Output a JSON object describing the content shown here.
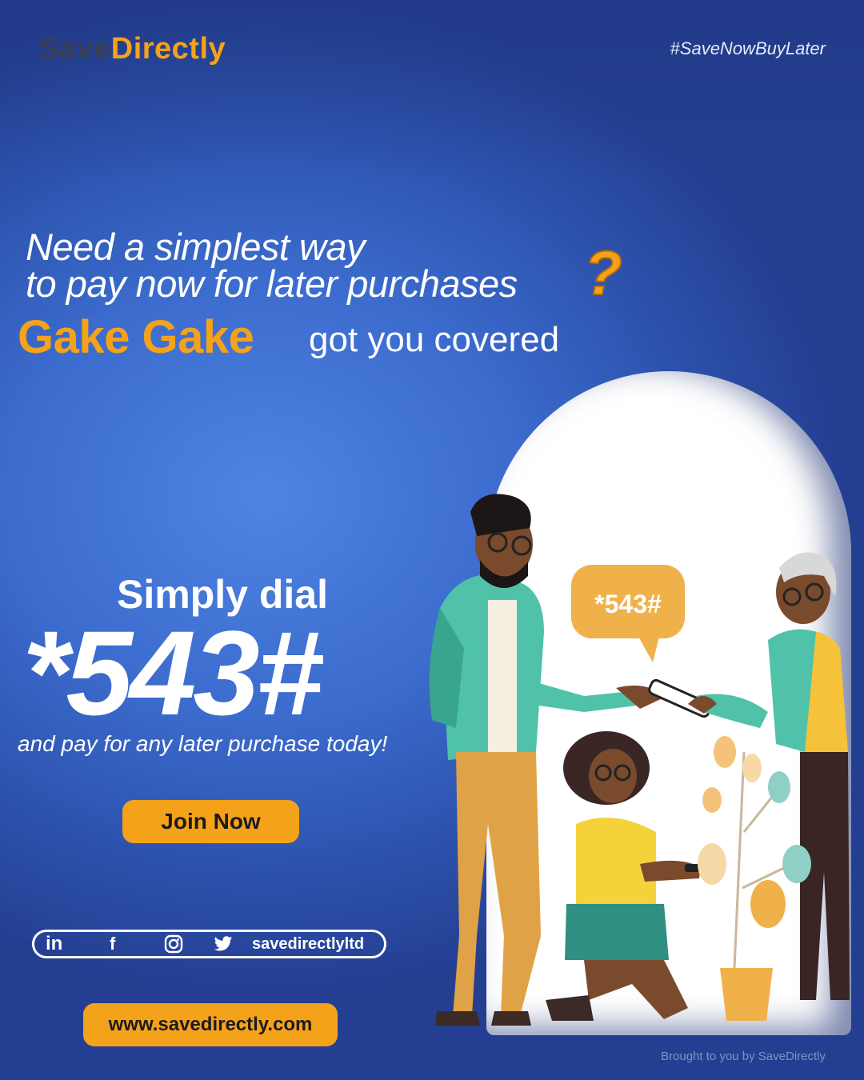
{
  "brand": {
    "part1": "Save",
    "part2": "Directly"
  },
  "hashtag": "#SaveNowBuyLater",
  "headline": {
    "line1": "Need a simplest way",
    "line2": "to pay now for later purchases",
    "question_mark": "?",
    "highlight": "Gake Gake",
    "rest": "got you covered"
  },
  "dial": {
    "lead": "Simply dial",
    "code": "*543#",
    "tagline": "and pay for any later purchase today!"
  },
  "bubble": {
    "text": "*543#"
  },
  "cta": {
    "join_label": "Join Now"
  },
  "social": {
    "icons": [
      "linkedin-icon",
      "facebook-icon",
      "instagram-icon",
      "twitter-icon"
    ],
    "linkedin_glyph": "in",
    "facebook_glyph": "f",
    "handle": "savedirectlyltd"
  },
  "website": "www.savedirectly.com",
  "footer": "Brought to you by SaveDirectly",
  "colors": {
    "accent": "#f5a21b",
    "background": "#3b6bcd",
    "text": "#ffffff",
    "teal": "#4fc2a9"
  }
}
